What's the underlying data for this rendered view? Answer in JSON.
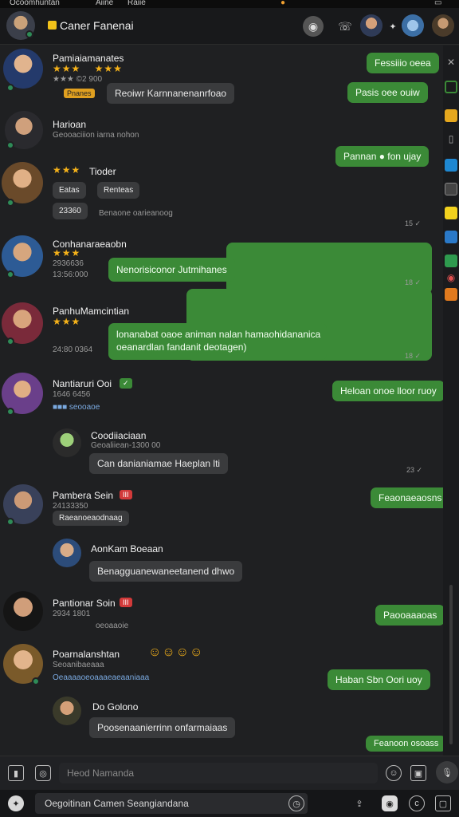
{
  "statusbar": {
    "left_text": "Ocoomhuntan",
    "mid_text": "Aiine",
    "mid2_text": "Raiie"
  },
  "header": {
    "title": "Caner Fanenai"
  },
  "messages": {
    "m1": {
      "name": "Pamiaiamanates",
      "sub": "★★★ ©2 900",
      "badge": "Pnanes",
      "bubble": "Reoiwr Karnnanenanrfoao"
    },
    "m1_out": "Fessiiio oeea",
    "m2_out": "Pasis oee ouiw",
    "m2": {
      "name": "Harioan",
      "sub": "Geooaciiion iarna nohon"
    },
    "m3_out": "Pannan ● fon ujay",
    "m3": {
      "name": "Tioder",
      "chip1": "Eatas",
      "chip2": "Renteas",
      "chip3": "23360",
      "sub": "Benaone oarieanoog",
      "time": "15 ✓"
    },
    "m4": {
      "name": "Conhanaraeaobn",
      "sub1": "2936636",
      "sub2": "13:56:000",
      "bubble": "Nenorisiconor Jutmihanes",
      "time": "18 ✓"
    },
    "m5": {
      "name": "PanhuMamcintian",
      "sub": "24:80 0364",
      "bubble_line1": "lonanabat oaoe animan nalan hamaohidananica",
      "bubble_line2": "oeanardlan fandanit deotagen)",
      "time": "18 ✓"
    },
    "m6": {
      "name": "Nantiaruri Ooi",
      "sub": "1646 6456",
      "sub2": "■■■ seooaoe",
      "out": "Heloan onoe lloor ruoy"
    },
    "m7": {
      "name": "Coodiiaciaan",
      "sub": "Geoaliiean-1300 00",
      "bubble": "Can danianiamae Haeplan lti",
      "time": "23 ✓"
    },
    "m8": {
      "name": "Pambera Sein",
      "tag": "III",
      "sub": "24133350",
      "chip": "Raeanoeaodnaag",
      "out": "Feaonaeaosns"
    },
    "m9": {
      "name": "AonKam Boeaan",
      "bubble": "Benagguanewaneetanend dhwo"
    },
    "m10": {
      "name": "Pantionar Soin",
      "tag": "III",
      "sub1": "2934 1801",
      "sub2": "oeoaaoie",
      "out": "Paooaaaoas"
    },
    "m11": {
      "name": "Poarnalanshtan",
      "sub": "Seoanibaeaaa",
      "sub2": "Oeaaaaoeoaaaeaeaaniaaa",
      "out": "Haban Sbn Oori uoy"
    },
    "m12": {
      "name": "Do Golono",
      "bubble": "Poosenaanierrinn onfarmaiaas"
    },
    "m13_out": "Feanoon osoass"
  },
  "composer": {
    "placeholder": "Heod Namanda"
  },
  "bottom": {
    "search": "Oegoitinan Camen Seangiandana"
  },
  "colors": {
    "accent": "#3b8a37",
    "bg": "#1f2022",
    "in_bubble": "#3a3b3d"
  }
}
